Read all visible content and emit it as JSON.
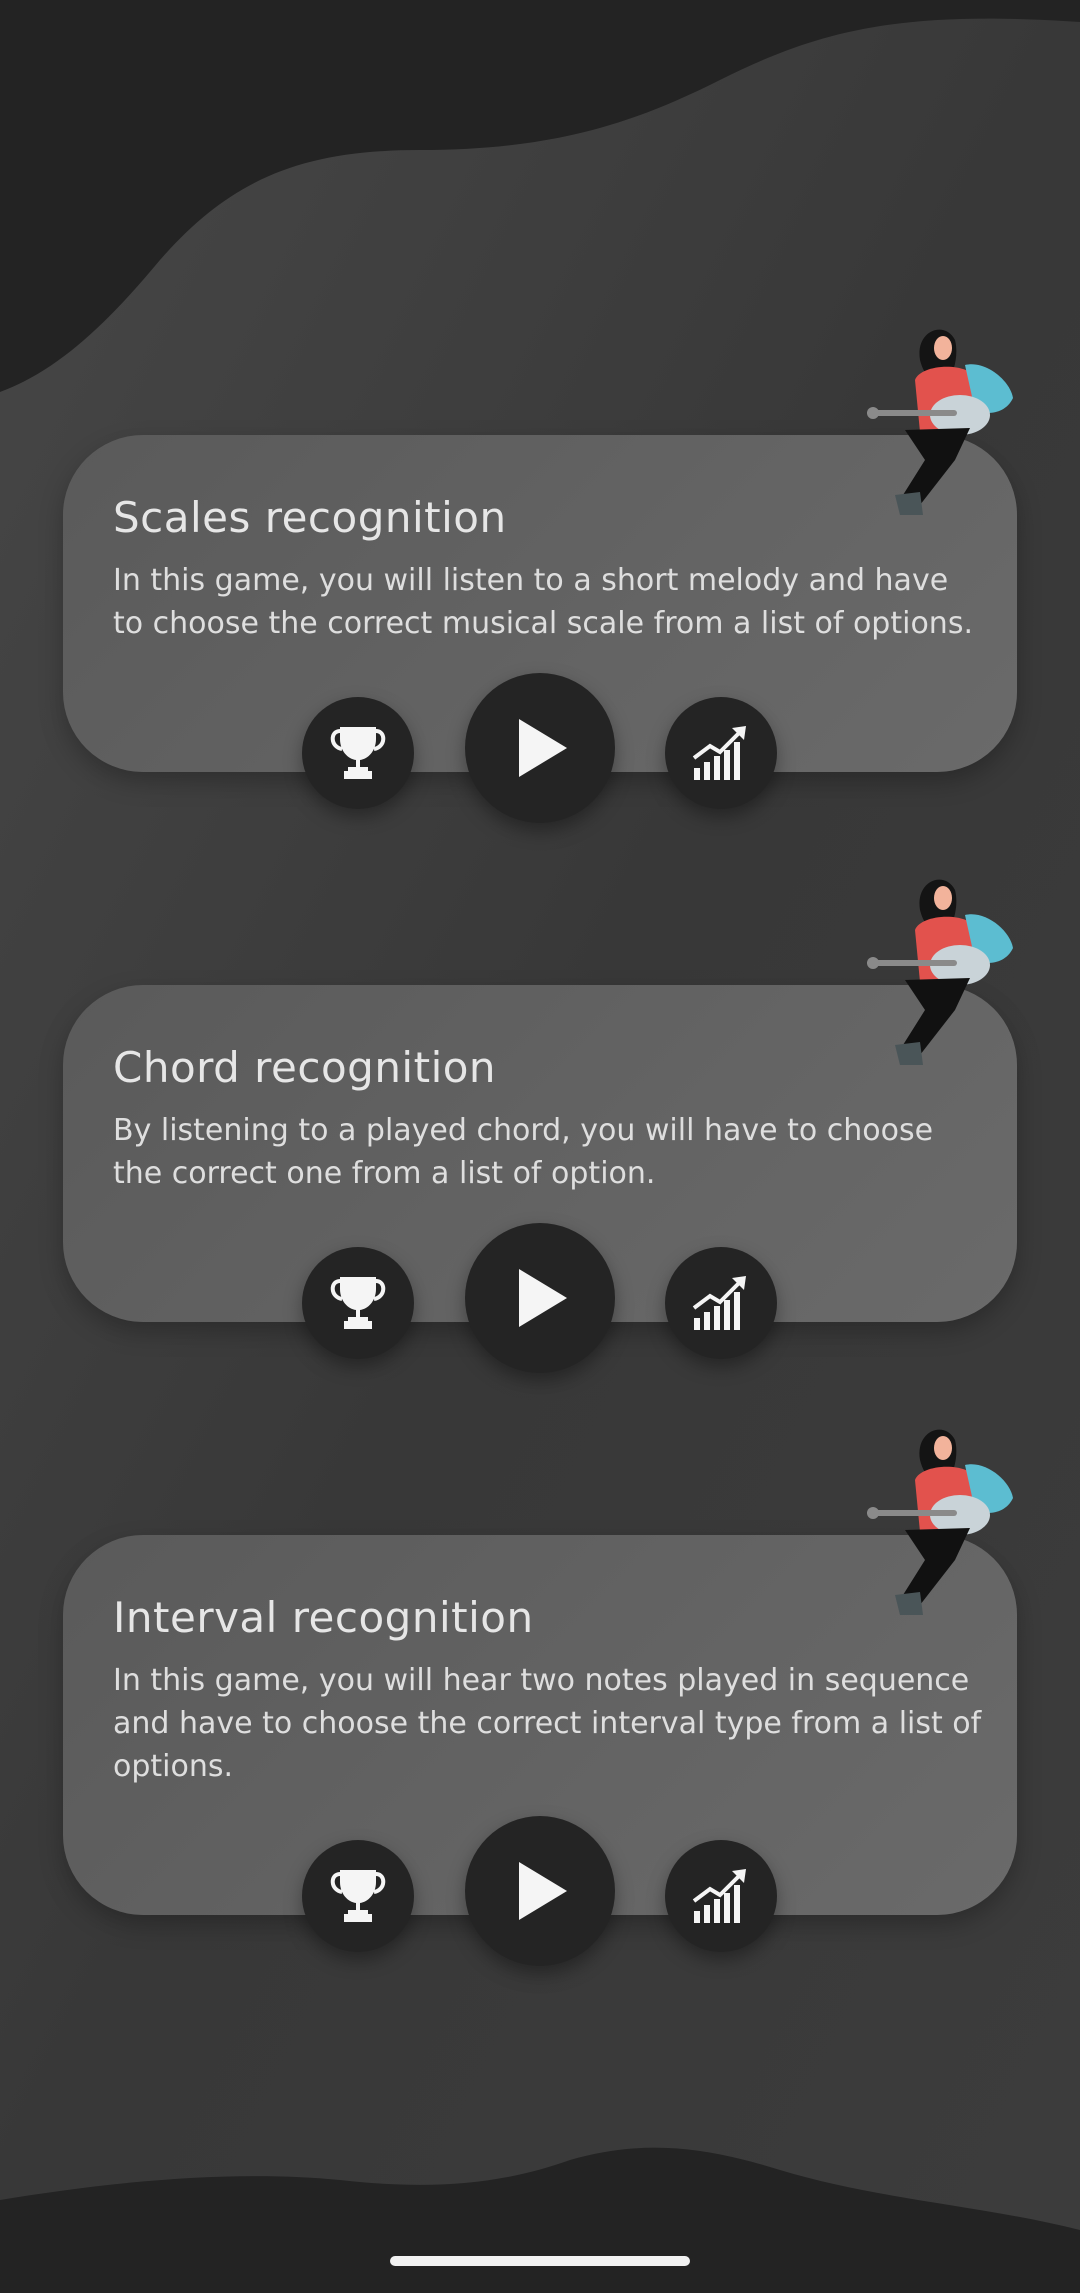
{
  "games": [
    {
      "title": "Scales recognition",
      "description": "In this game, you will listen to a short melody and have to choose the correct musical scale from a list of options."
    },
    {
      "title": "Chord recognition",
      "description": "By listening to a played chord, you will have to choose the correct one from a list of option."
    },
    {
      "title": "Interval recognition",
      "description": "In this game, you will hear two notes played in sequence and have to choose the correct interval type from a list of options."
    }
  ],
  "icons": {
    "achievements": "trophy-icon",
    "play": "play-icon",
    "stats": "stats-chart-icon"
  },
  "colors": {
    "background_dark": "#232323",
    "background_blob": "#3c3c3c",
    "card": "#626262",
    "button": "#242424"
  }
}
